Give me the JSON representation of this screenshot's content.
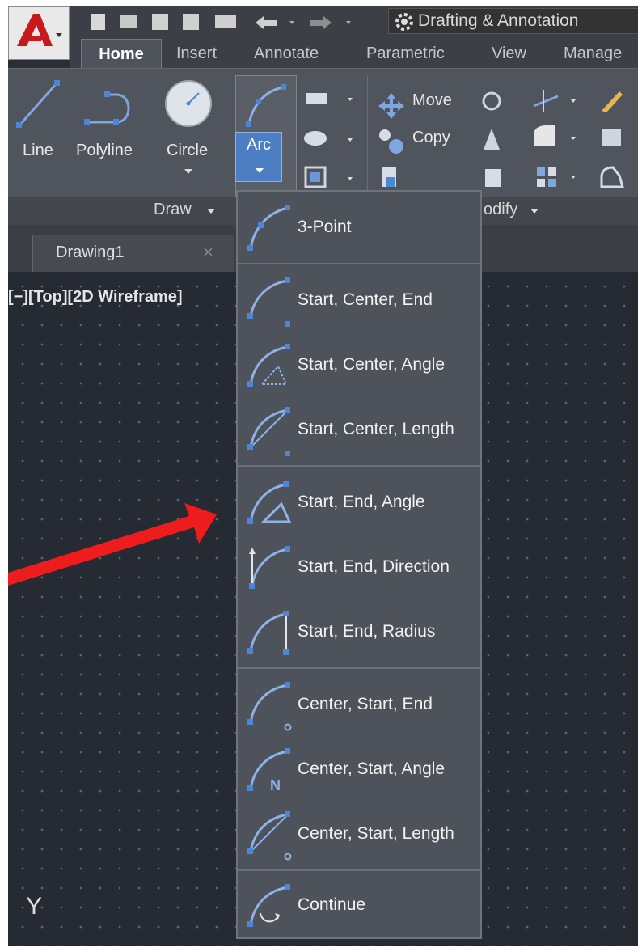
{
  "workspace": {
    "label": "Drafting & Annotation"
  },
  "tabs": [
    "Home",
    "Insert",
    "Annotate",
    "Parametric",
    "View",
    "Manage"
  ],
  "ribbon": {
    "tools": {
      "line": "Line",
      "polyline": "Polyline",
      "circle": "Circle",
      "arc": "Arc"
    },
    "modify_tools": {
      "move": "Move",
      "copy": "Copy"
    },
    "panels": {
      "draw": "Draw",
      "modify": "odify"
    }
  },
  "document": {
    "tab_label": "Drawing1",
    "close_glyph": "×"
  },
  "viewport": {
    "label": "[−][Top][2D Wireframe]",
    "axis": "Y"
  },
  "arc_menu": {
    "groups": [
      [
        "3-Point"
      ],
      [
        "Start, Center, End",
        "Start, Center, Angle",
        "Start, Center, Length"
      ],
      [
        "Start, End, Angle",
        "Start, End, Direction",
        "Start, End, Radius"
      ],
      [
        "Center, Start, End",
        "Center, Start, Angle",
        "Center, Start, Length"
      ],
      [
        "Continue"
      ]
    ],
    "angle_icon_letter": "N"
  },
  "colors": {
    "accent": "#4c7ec4",
    "arrow": "#ee1c1c",
    "canvas": "#252a33",
    "ribbon": "#50545c"
  }
}
